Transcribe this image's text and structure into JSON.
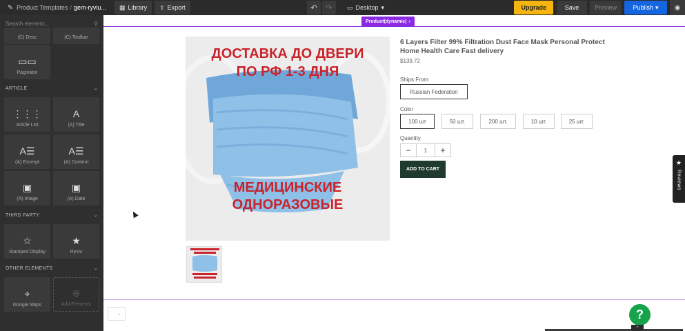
{
  "topbar": {
    "breadcrumb_root": "Product Templates",
    "breadcrumb_sep": "/",
    "breadcrumb_current": "gem-ryviu...",
    "library_label": "Library",
    "export_label": "Export",
    "device_label": "Desktop",
    "upgrade_label": "Upgrade",
    "save_label": "Save",
    "preview_label": "Preview",
    "publish_label": "Publish"
  },
  "sidebar": {
    "search_placeholder": "Search element...",
    "top_tiles": [
      "(C) Desc",
      "(C) Toolbar"
    ],
    "paginator": "Paginator",
    "article_section": "ARTICLE",
    "article_tiles": [
      "Article List",
      "(A) Title",
      "(A) Excerpt",
      "(A) Content",
      "(A) Image",
      "(A) Date"
    ],
    "third_party_section": "THIRD PARTY",
    "third_party_tiles": [
      "Stamped Display",
      "Ryviu"
    ],
    "other_section": "OTHER ELEMENTS",
    "other_tiles": [
      "Google Maps",
      "Add Elements"
    ]
  },
  "canvas": {
    "product_tag": "Product(dynamic)",
    "image_text_top_1": "ДОСТАВКА ДО ДВЕРИ",
    "image_text_top_2": "ПО РФ 1-3 ДНЯ",
    "image_text_bottom_1": "МЕДИЦИНСКИЕ",
    "image_text_bottom_2": "ОДНОРАЗОВЫЕ",
    "product_title": "6 Layers Filter 99% Filtration Dust Face Mask Personal Protect Home Health Care Fast delivery",
    "price": "$139.72",
    "ships_from_label": "Ships From",
    "ships_from_value": "Russian Federation",
    "color_label": "Color",
    "color_options": [
      "100 шт",
      "50 шт.",
      "200 шт.",
      "10 шт.",
      "25 шт."
    ],
    "quantity_label": "Quantity",
    "quantity_value": "1",
    "add_to_cart": "ADD TO CART",
    "reviews_tab": "Reviews",
    "help": "?"
  },
  "colors": {
    "accent_purple": "#8a2be2",
    "upgrade": "#f6b40e",
    "publish": "#1565e0",
    "add_to_cart": "#1f3a2e",
    "help": "#16a34a",
    "image_text": "#c9232b"
  }
}
